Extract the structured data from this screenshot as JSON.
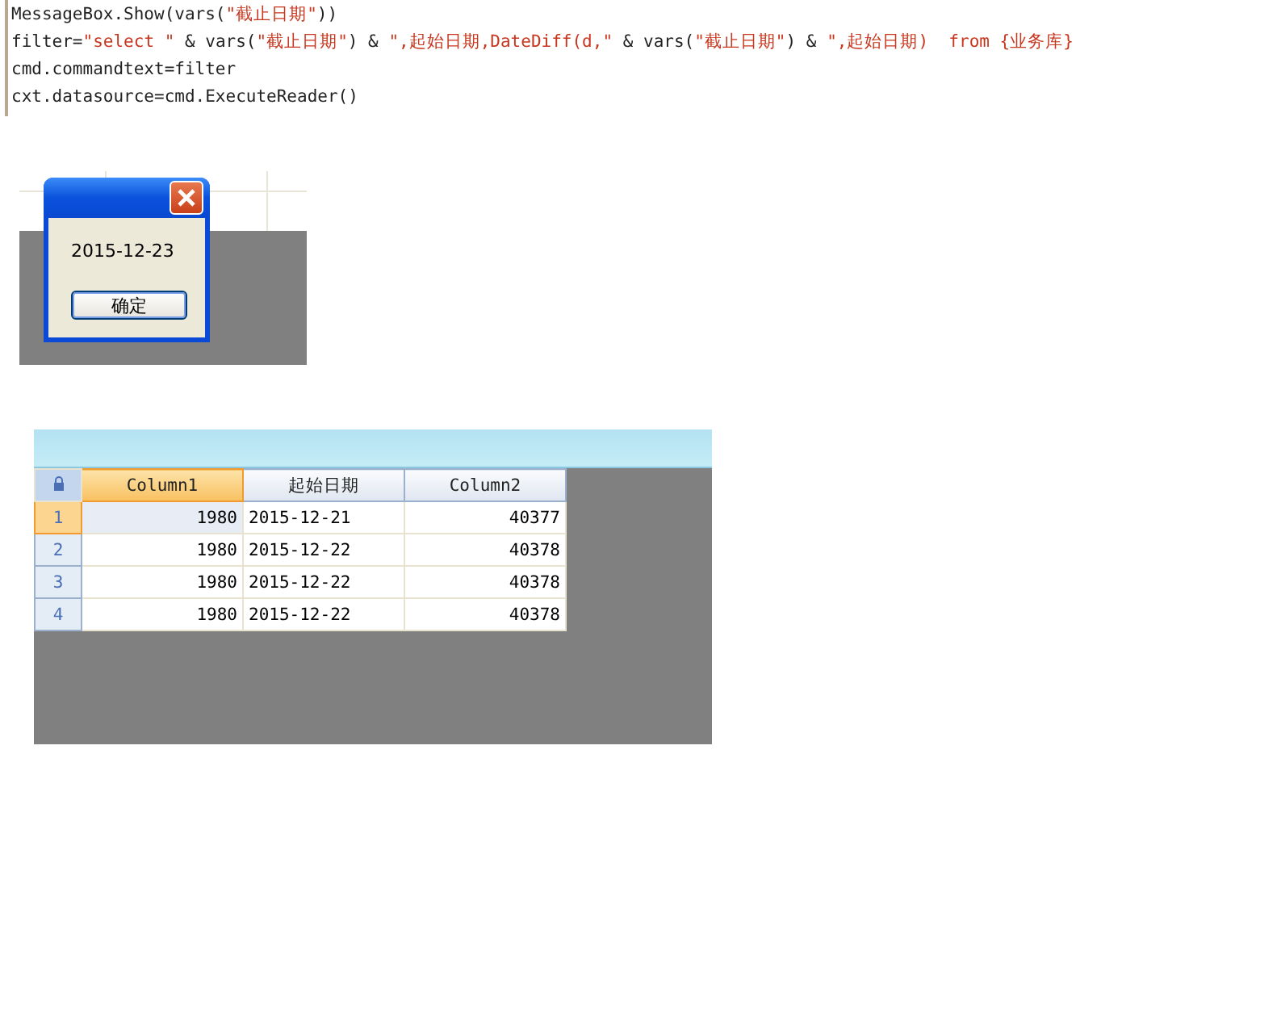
{
  "code_lines": [
    {
      "segments": [
        {
          "kind": "plain",
          "text": "MessageBox.Show(vars("
        },
        {
          "kind": "string",
          "text": "\"截止日期\""
        },
        {
          "kind": "plain",
          "text": "))"
        }
      ]
    },
    {
      "segments": [
        {
          "kind": "plain",
          "text": "filter="
        },
        {
          "kind": "string",
          "text": "\"select \""
        },
        {
          "kind": "plain",
          "text": " & vars("
        },
        {
          "kind": "string",
          "text": "\"截止日期\""
        },
        {
          "kind": "plain",
          "text": ") & "
        },
        {
          "kind": "string",
          "text": "\",起始日期,DateDiff(d,\""
        },
        {
          "kind": "plain",
          "text": " & vars("
        },
        {
          "kind": "string",
          "text": "\"截止日期\""
        },
        {
          "kind": "plain",
          "text": ") & "
        },
        {
          "kind": "string",
          "text": "\",起始日期)  from {业务库}"
        }
      ]
    },
    {
      "segments": [
        {
          "kind": "plain",
          "text": "cmd.commandtext=filter"
        }
      ]
    },
    {
      "segments": [
        {
          "kind": "plain",
          "text": "cxt.datasource=cmd.ExecuteReader()"
        }
      ]
    }
  ],
  "message_box": {
    "message": "2015-12-23",
    "button": "确定"
  },
  "grid": {
    "columns": [
      {
        "label": "Column1",
        "selected": true,
        "kind": "number"
      },
      {
        "label": "起始日期",
        "selected": false,
        "kind": "text"
      },
      {
        "label": "Column2",
        "selected": false,
        "kind": "number"
      }
    ],
    "rows": [
      {
        "number": "1",
        "selected": true,
        "cells": [
          "1980",
          "2015-12-21",
          "40377"
        ]
      },
      {
        "number": "2",
        "selected": false,
        "cells": [
          "1980",
          "2015-12-22",
          "40378"
        ]
      },
      {
        "number": "3",
        "selected": false,
        "cells": [
          "1980",
          "2015-12-22",
          "40378"
        ]
      },
      {
        "number": "4",
        "selected": false,
        "cells": [
          "1980",
          "2015-12-22",
          "40378"
        ]
      }
    ]
  }
}
